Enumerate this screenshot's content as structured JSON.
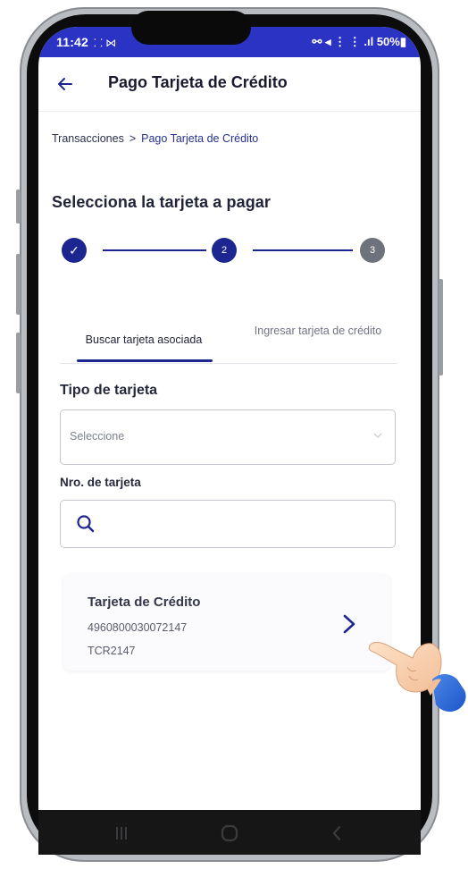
{
  "status_bar": {
    "time": "11:42",
    "left_icons": "⸬ ⋈",
    "right_text": "⚯ ◂ ⋮ ⋮ .ıl 50%▮"
  },
  "app_bar": {
    "back_icon": "arrow-left-icon",
    "title": "Pago Tarjeta de Crédito"
  },
  "breadcrumb": {
    "items": [
      "Transacciones",
      "Pago Tarjeta de Crédito"
    ],
    "separator": ">"
  },
  "section_title": "Selecciona la tarjeta a pagar",
  "stepper": {
    "steps": [
      {
        "label": "✓",
        "state": "done"
      },
      {
        "label": "2",
        "state": "current"
      },
      {
        "label": "3",
        "state": "pending"
      }
    ],
    "colors": {
      "active": "#1d2690",
      "pending": "#6e727b"
    }
  },
  "tabs": [
    {
      "label": "Buscar tarjeta asociada",
      "selected": true
    },
    {
      "label": "Ingresar tarjeta de crédito",
      "selected": false
    }
  ],
  "form": {
    "card_type_label": "Tipo de tarjeta",
    "card_type_placeholder": "Seleccione",
    "card_number_label": "Nro. de tarjeta",
    "card_number_value": ""
  },
  "result_card": {
    "title": "Tarjeta de Crédito",
    "number": "4960800030072147",
    "code": "TCR2147"
  },
  "colors": {
    "status_bar": "#2b33c4",
    "accent": "#1d2690"
  }
}
